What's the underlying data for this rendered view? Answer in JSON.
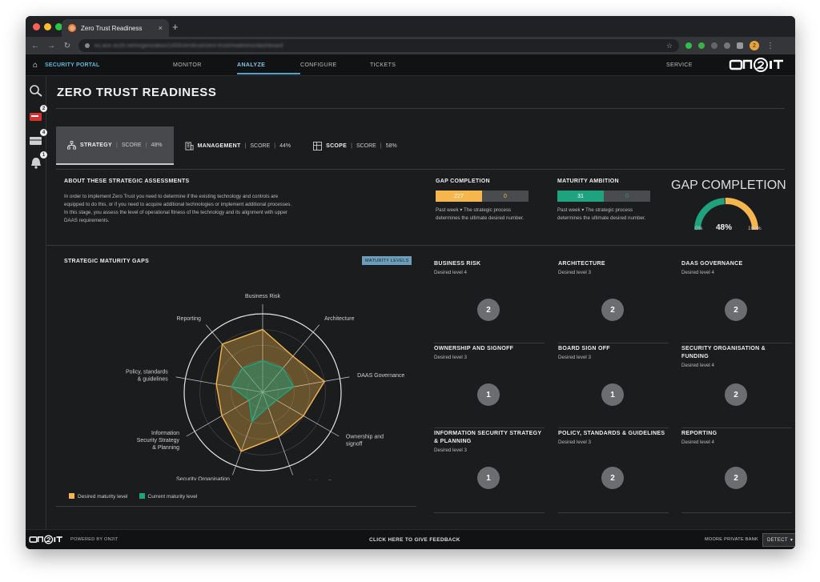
{
  "browser": {
    "tab_title": "Zero Trust Readiness",
    "tab_close": "×",
    "new_tab": "+",
    "url": "eu.ace.on2it.net/organization/1433/zerotrust/zero-trust/readiness/dashboard",
    "profile_initial": "2"
  },
  "header": {
    "portal_label": "SECURITY PORTAL",
    "nav": [
      {
        "label": "MONITOR",
        "active": false
      },
      {
        "label": "ANALYZE",
        "active": true
      },
      {
        "label": "CONFIGURE",
        "active": false
      },
      {
        "label": "TICKETS",
        "active": false
      }
    ],
    "service": "SERVICE"
  },
  "sidebar": {
    "badges": [
      "2",
      "4",
      "1"
    ]
  },
  "page": {
    "title": "ZERO TRUST READINESS"
  },
  "tabs": [
    {
      "label": "STRATEGY",
      "score_label": "SCORE",
      "score": "48%",
      "active": true
    },
    {
      "label": "MANAGEMENT",
      "score_label": "SCORE",
      "score": "44%",
      "active": false
    },
    {
      "label": "SCOPE",
      "score_label": "SCORE",
      "score": "58%",
      "active": false
    }
  ],
  "about": {
    "title": "ABOUT THESE STRATEGIC ASSESSMENTS",
    "text": "In order to implement Zero Trust you need to determine if the existing technology and controls are equipped to do this, or if you need to acquire additional technologies or implement additional processes. In this stage, you assess the level of operational fitness of the technology and its alignment with upper DAAS requirements."
  },
  "gap_completion": {
    "title": "GAP COMPLETION",
    "value_a": "227",
    "value_b": "0",
    "period": "Past week ▾",
    "desc": "The strategic process determines the ultimate desired number."
  },
  "maturity_ambition": {
    "title": "MATURITY AMBITION",
    "value_a": "31",
    "value_b": "0",
    "period": "Past week ▾",
    "desc": "The strategic process determines the ultimate desired number."
  },
  "gauge": {
    "title": "GAP COMPLETION",
    "min_label": "0%",
    "max_label": "100%",
    "value_label": "48%",
    "value": 48
  },
  "gaps": {
    "title": "STRATEGIC MATURITY GAPS",
    "levels_button": "MATURITY LEVELS",
    "legend_desired": "Desired maturity level",
    "legend_current": "Current maturity level"
  },
  "chart_data": {
    "type": "radar",
    "categories": [
      "Business Risk",
      "Architecture",
      "DAAS Governance",
      "Ownership and signoff",
      "Board Sign off",
      "Security Organisation & Funding",
      "Information Security Strategy & Planning",
      "Policy, standards & guidelines",
      "Reporting"
    ],
    "series": [
      {
        "name": "Desired maturity level",
        "values": [
          4,
          3,
          4,
          3,
          3,
          4,
          3,
          3,
          4
        ],
        "color": "#f5b74d"
      },
      {
        "name": "Current maturity level",
        "values": [
          2,
          2,
          2,
          1,
          1,
          2,
          1,
          2,
          2
        ],
        "color": "#1fa37f"
      }
    ],
    "rmax": 5
  },
  "cards": [
    {
      "title": "BUSINESS RISK",
      "sub": "Desired level 4",
      "value": "2"
    },
    {
      "title": "ARCHITECTURE",
      "sub": "Desired level 3",
      "value": "2"
    },
    {
      "title": "DAAS GOVERNANCE",
      "sub": "Desired level 4",
      "value": "2"
    },
    {
      "title": "OWNERSHIP AND SIGNOFF",
      "sub": "Desired level 3",
      "value": "1"
    },
    {
      "title": "BOARD SIGN OFF",
      "sub": "Desired level 3",
      "value": "1"
    },
    {
      "title": "SECURITY ORGANISATION & FUNDING",
      "sub": "Desired level 4",
      "value": "2"
    },
    {
      "title": "INFORMATION SECURITY STRATEGY & PLANNING",
      "sub": "Desired level 3",
      "value": "1"
    },
    {
      "title": "POLICY, STANDARDS & GUIDELINES",
      "sub": "Desired level 3",
      "value": "2"
    },
    {
      "title": "REPORTING",
      "sub": "Desired level 4",
      "value": "2"
    }
  ],
  "footer": {
    "powered": "POWERED BY ON2IT",
    "feedback": "CLICK HERE TO GIVE FEEDBACK",
    "org": "MOORE PRIVATE BANK",
    "detect": "DETECT",
    "detect_caret": "▾"
  },
  "colors": {
    "orange": "#f5b74d",
    "green": "#1fa37f",
    "blue_accent": "#5fb7d8"
  }
}
